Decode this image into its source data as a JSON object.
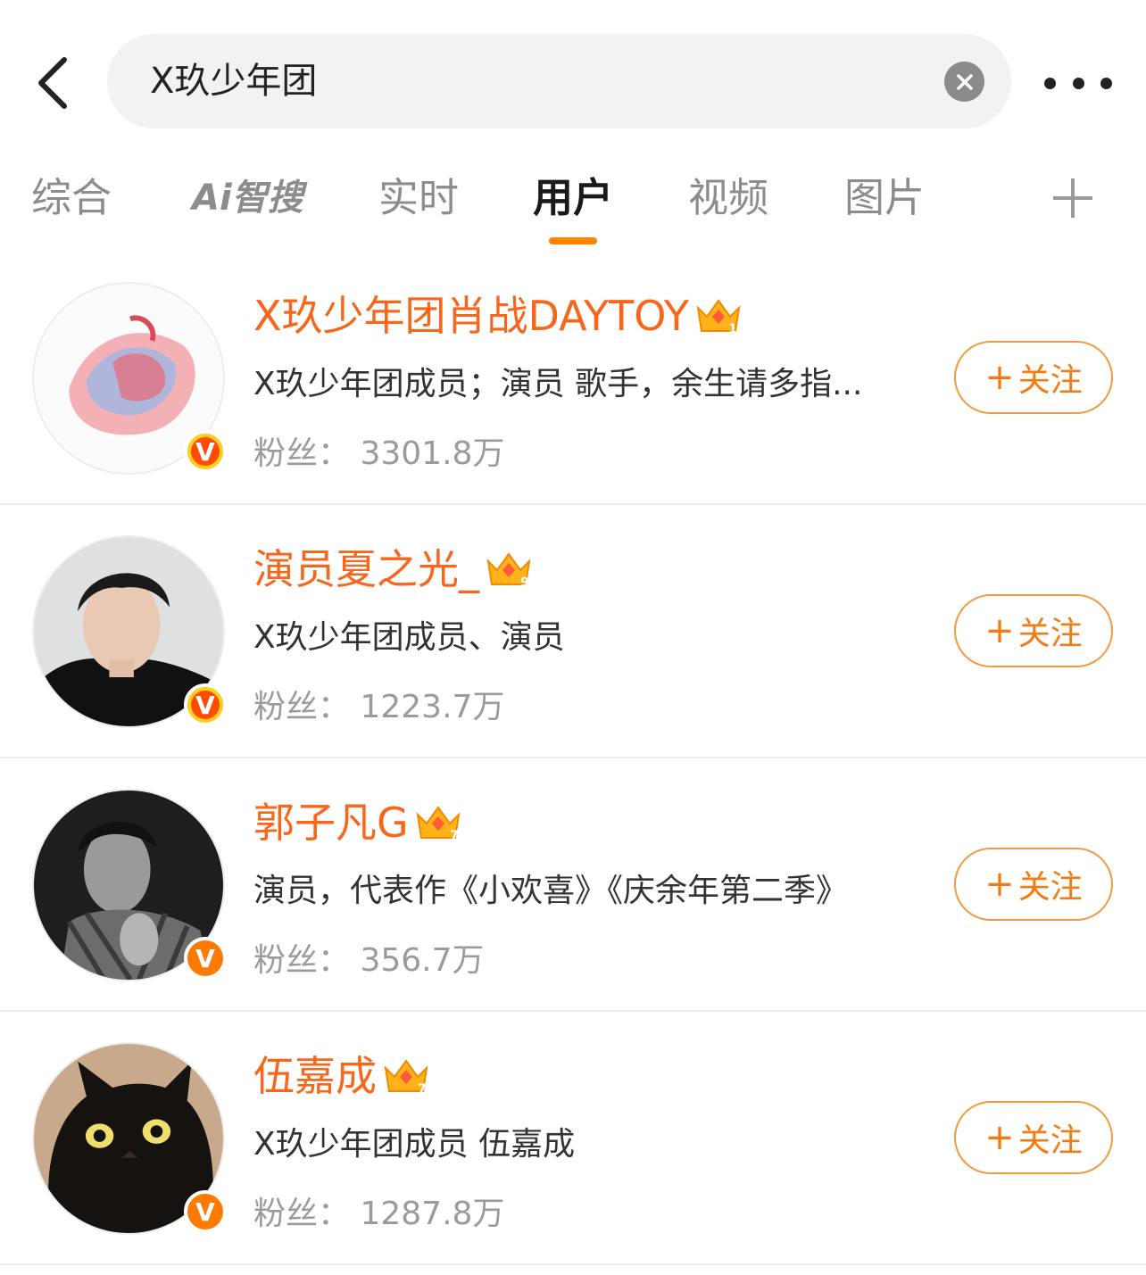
{
  "search": {
    "query": "X玖少年团"
  },
  "tabs": [
    {
      "label": "综合",
      "active": false
    },
    {
      "label": "Ai智搜",
      "active": false
    },
    {
      "label": "实时",
      "active": false
    },
    {
      "label": "用户",
      "active": true
    },
    {
      "label": "视频",
      "active": false
    },
    {
      "label": "图片",
      "active": false
    }
  ],
  "colors": {
    "accent": "#ff8200",
    "name": "#f8661c",
    "follow": "#f47a12"
  },
  "follow_label": "关注",
  "users": [
    {
      "name": "X玖少年团肖战DAYTOY",
      "description": "X玖少年团成员；演员 歌手，余生请多指...",
      "fans_label": "粉丝：",
      "fans": "3301.8万",
      "crown_level": "10",
      "badge": "gold"
    },
    {
      "name": "演员夏之光_",
      "description": "X玖少年团成员、演员",
      "fans_label": "粉丝：",
      "fans": "1223.7万",
      "crown_level": "9",
      "badge": "gold"
    },
    {
      "name": "郭子凡G",
      "description": "演员，代表作《小欢喜》《庆余年第二季》",
      "fans_label": "粉丝：",
      "fans": "356.7万",
      "crown_level": "7",
      "badge": "orange"
    },
    {
      "name": "伍嘉成",
      "description": "X玖少年团成员  伍嘉成",
      "fans_label": "粉丝：",
      "fans": "1287.8万",
      "crown_level": "7",
      "badge": "orange"
    }
  ]
}
